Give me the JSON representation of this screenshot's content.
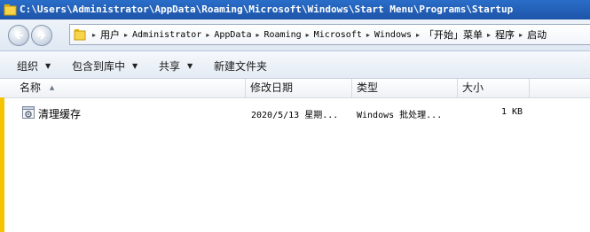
{
  "window": {
    "title": "C:\\Users\\Administrator\\AppData\\Roaming\\Microsoft\\Windows\\Start Menu\\Programs\\Startup"
  },
  "address_bar": {
    "crumbs": [
      "用户",
      "Administrator",
      "AppData",
      "Roaming",
      "Microsoft",
      "Windows",
      "「开始」菜单",
      "程序",
      "启动"
    ]
  },
  "toolbar": {
    "organize": "组织",
    "include_in_library": "包含到库中",
    "share": "共享",
    "new_folder": "新建文件夹"
  },
  "columns": {
    "name": "名称",
    "modified": "修改日期",
    "type": "类型",
    "size": "大小"
  },
  "files": [
    {
      "name": "清理缓存",
      "modified": "2020/5/13 星期...",
      "type": "Windows 批处理...",
      "size": "1 KB"
    }
  ],
  "icons": {
    "back": "back-arrow-icon",
    "forward": "forward-arrow-icon",
    "folder": "folder-icon",
    "batch_file": "batch-file-gear-icon"
  },
  "colors": {
    "titlebar": "#1d54a8",
    "folder": "#f4c400"
  }
}
